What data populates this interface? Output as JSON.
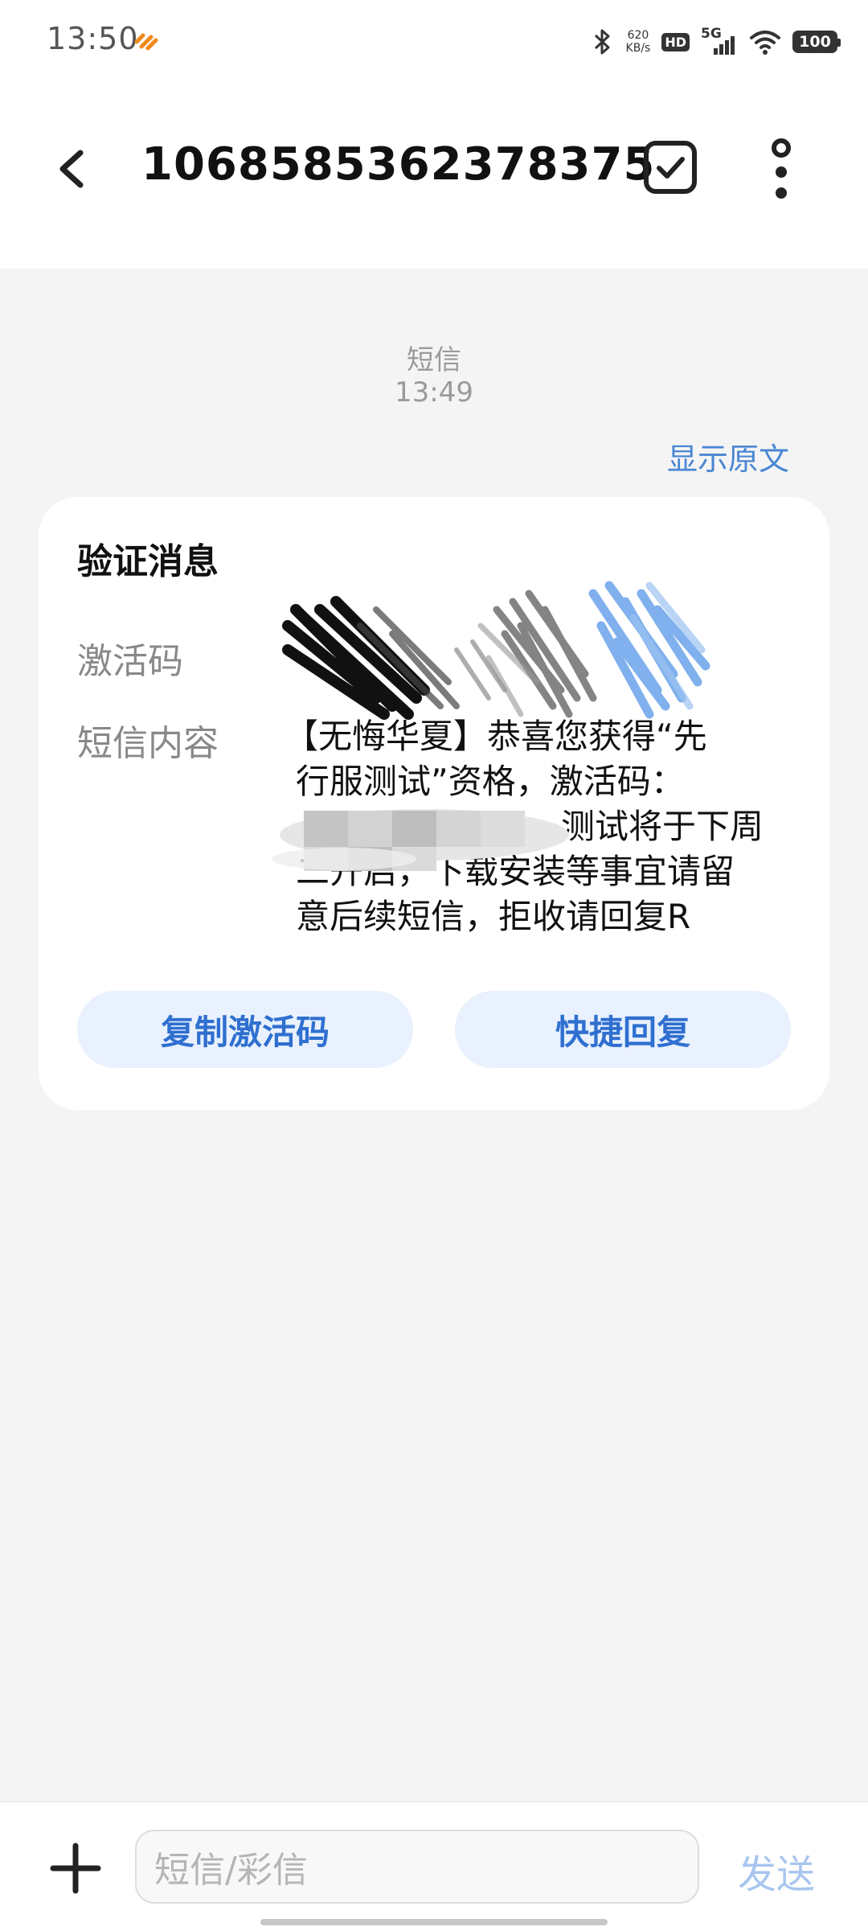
{
  "status_bar": {
    "time": "13:50",
    "net_speed_value": "620",
    "net_speed_unit": "KB/s",
    "hd_label": "HD",
    "network_label": "5G",
    "battery": "100"
  },
  "header": {
    "title": "1068585362378375",
    "icons": [
      "back-arrow-icon",
      "checkbox-select-icon",
      "more-vertical-icon"
    ]
  },
  "message_meta": {
    "type": "短信",
    "time": "13:49"
  },
  "show_original_label": "显示原文",
  "card": {
    "title": "验证消息",
    "activation_label": "激活码",
    "content_label": "短信内容",
    "content_lines": [
      "【无悔华夏】恭喜您获得“先",
      "行服测试”资格，激活码：",
      "测试将于下周",
      "二开启，下载安装等事宜请留",
      "意后续短信，拒收请回复R"
    ],
    "copy_button": "复制激活码",
    "reply_button": "快捷回复"
  },
  "bottom_bar": {
    "input_placeholder": "短信/彩信",
    "send_label": "发送"
  },
  "colors": {
    "accent": "#2f6fd0",
    "pill_bg": "#e8f1fd",
    "background": "#f4f4f4"
  }
}
